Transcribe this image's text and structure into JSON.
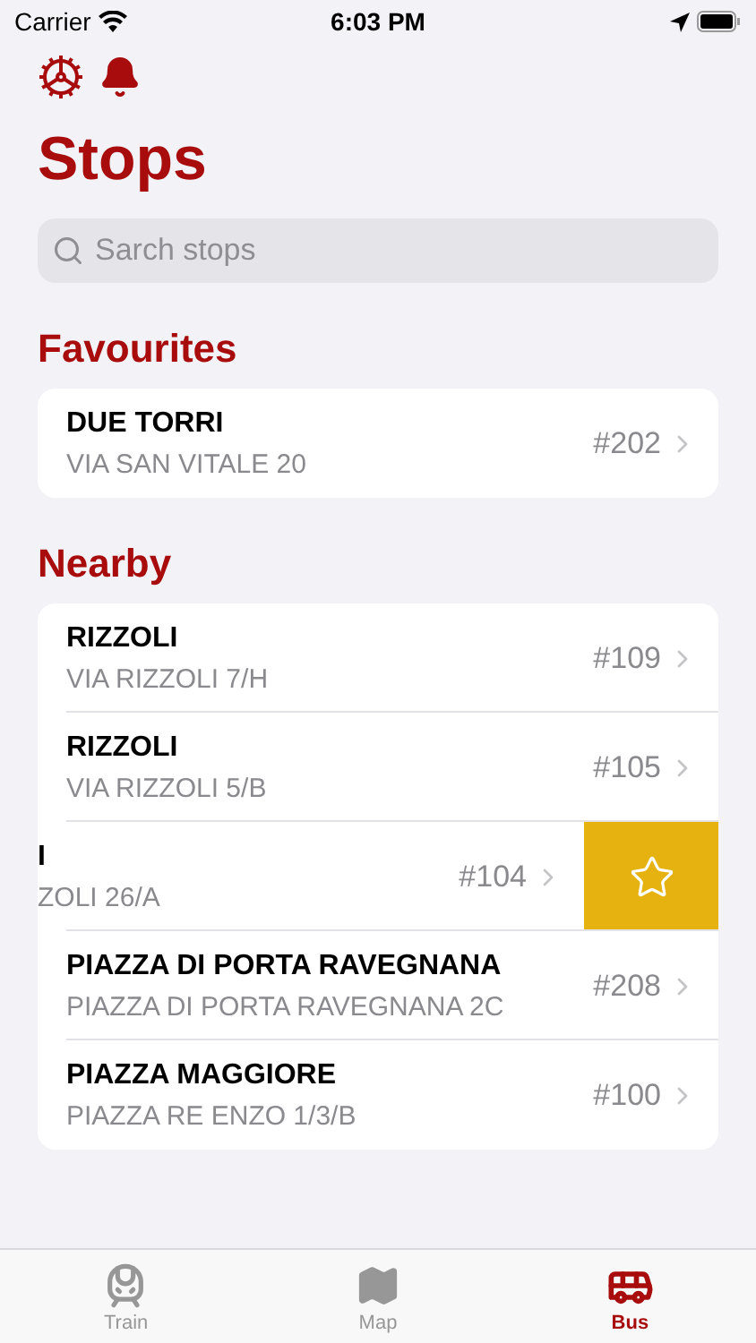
{
  "status_bar": {
    "carrier": "Carrier",
    "time": "6:03 PM"
  },
  "title": "Stops",
  "search": {
    "placeholder": "Sarch stops"
  },
  "sections": [
    {
      "title": "Favourites",
      "stops": [
        {
          "name": "DUE TORRI",
          "address": "VIA SAN VITALE 20",
          "number": "#202",
          "swiped": false
        }
      ]
    },
    {
      "title": "Nearby",
      "stops": [
        {
          "name": "RIZZOLI",
          "address": "VIA RIZZOLI 7/H",
          "number": "#109",
          "swiped": false
        },
        {
          "name": "RIZZOLI",
          "address": "VIA RIZZOLI 5/B",
          "number": "#105",
          "swiped": false
        },
        {
          "name": "I",
          "address": "ZOLI 26/A",
          "number": "#104",
          "swiped": true
        },
        {
          "name": "PIAZZA DI PORTA RAVEGNANA",
          "address": "PIAZZA DI PORTA RAVEGNANA 2C",
          "number": "#208",
          "swiped": false
        },
        {
          "name": "PIAZZA MAGGIORE",
          "address": "PIAZZA RE ENZO 1/3/B",
          "number": "#100",
          "swiped": false
        }
      ]
    }
  ],
  "tabs": [
    {
      "kind": "train",
      "label": "Train",
      "selected": false
    },
    {
      "kind": "map",
      "label": "Map",
      "selected": false
    },
    {
      "kind": "bus",
      "label": "Bus",
      "selected": true
    }
  ]
}
